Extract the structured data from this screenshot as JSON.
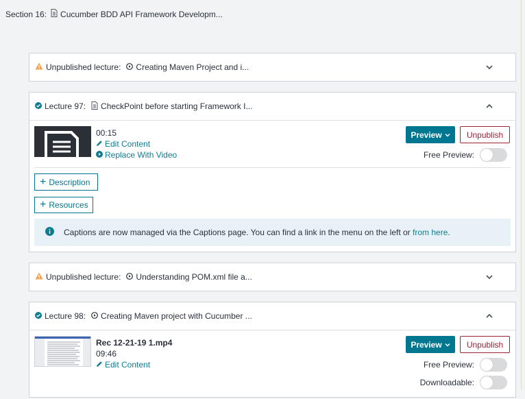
{
  "section": {
    "label": "Section 16:",
    "title": "Cucumber BDD API Framework Developm..."
  },
  "cards": [
    {
      "status": "Unpublished lecture:",
      "title": "Creating Maven Project and i..."
    },
    {
      "status": "Lecture 97:",
      "title": "CheckPoint before starting Framework I...",
      "duration": "00:15",
      "edit_label": "Edit Content",
      "replace_label": "Replace With Video",
      "preview_label": "Preview",
      "unpublish_label": "Unpublish",
      "free_preview_label": "Free Preview:",
      "description_label": "Description",
      "resources_label": "Resources",
      "info_text": "Captions are now managed via the Captions page. You can find a link in the menu on the left or",
      "info_link": "from here",
      "info_end": "."
    },
    {
      "status": "Unpublished lecture:",
      "title": "Understanding POM.xml file a..."
    },
    {
      "status": "Lecture 98:",
      "title": "Creating Maven project with Cucumber ...",
      "filename": "Rec 12-21-19 1.mp4",
      "duration": "09:46",
      "edit_label": "Edit Content",
      "preview_label": "Preview",
      "unpublish_label": "Unpublish",
      "free_preview_label": "Free Preview:",
      "downloadable_label": "Downloadable:"
    }
  ],
  "colors": {
    "accent": "#007791",
    "link": "#0f7c90",
    "warning": "#f4a14a",
    "unpublish": "#9b2335"
  }
}
